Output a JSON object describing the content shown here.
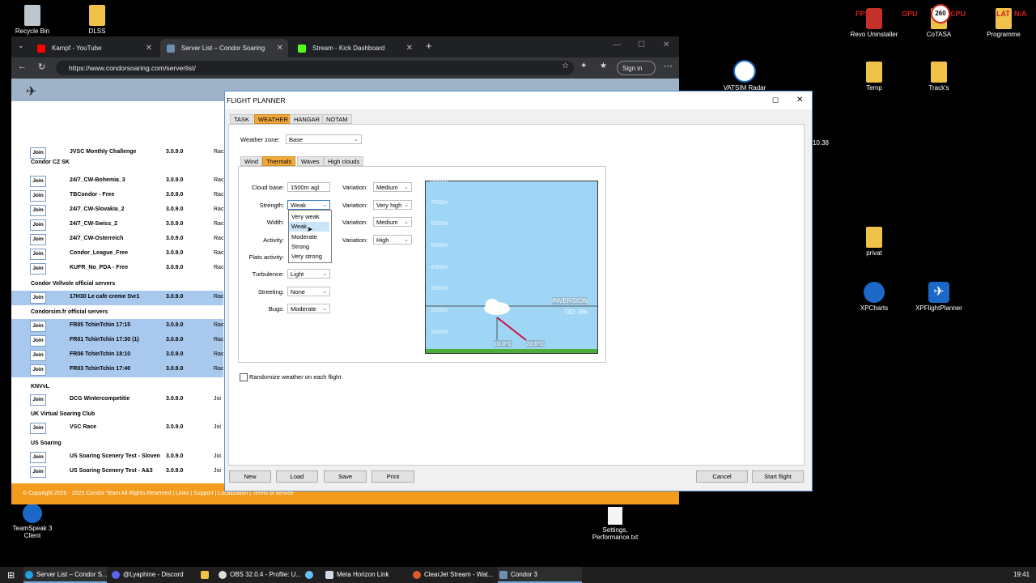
{
  "desktop": {
    "icons_left": [
      {
        "label": "Recycle Bin"
      },
      {
        "label": "DLSS"
      }
    ],
    "icons_right": [
      {
        "label": "Revo Uninstaller"
      },
      {
        "label": "CoTASA"
      },
      {
        "label": "Programme"
      },
      {
        "label": "VATSIM Radar"
      },
      {
        "label": "Temp"
      },
      {
        "label": "Track's"
      },
      {
        "label": "10.38"
      },
      {
        "label": "privat"
      },
      {
        "label": "XPCharts"
      },
      {
        "label": "XPFlightPlanner"
      },
      {
        "label": "Settings, Performance.txt"
      },
      {
        "label": "TeamSpeak 3 Client"
      }
    ],
    "overlay": {
      "fps": "FPS",
      "gpu": "GPU",
      "cpu": "CPU",
      "lat": "LAT",
      "lat_val": "N/A",
      "badge": "260"
    }
  },
  "browser": {
    "tabs": [
      {
        "label": "Kampf - YouTube",
        "fav_color": "#ff0000"
      },
      {
        "label": "Server List – Condor Soaring",
        "fav_color": "#6b8fb5"
      },
      {
        "label": "Stream - Kick Dashboard",
        "fav_color": "#53fc18"
      }
    ],
    "url": "https://www.condorsoaring.com/serverlist/",
    "signin": "Sign in",
    "server_rows": [
      {
        "name": "JVSC Monthly Challenge",
        "version": "3.0.9.0",
        "rc": "Rac",
        "sel": false
      },
      {
        "name": "24/7_CW-Bohemia_3",
        "version": "3.0.9.0",
        "rc": "Rac",
        "sel": false
      },
      {
        "name": "TBCondor - Free",
        "version": "3.0.9.0",
        "rc": "Rac",
        "sel": false
      },
      {
        "name": "24/7_CW-Slovakia_2",
        "version": "3.0.9.0",
        "rc": "Rac",
        "sel": false
      },
      {
        "name": "24/7_CW-Swiss_2",
        "version": "3.0.9.0",
        "rc": "Rac",
        "sel": false
      },
      {
        "name": "24/7_CW-Osterreich",
        "version": "3.0.9.0",
        "rc": "Rac",
        "sel": false
      },
      {
        "name": "Condor_League_Free",
        "version": "3.0.9.0",
        "rc": "Rac",
        "sel": false
      },
      {
        "name": "KUFR_No_PDA - Free",
        "version": "3.0.9.0",
        "rc": "Rac",
        "sel": false
      },
      {
        "name": "17H30 Le cafe creme Svr1",
        "version": "3.0.9.0",
        "rc": "Rac",
        "sel": true
      },
      {
        "name": "FR05 TchinTchin 17:15",
        "version": "3.0.9.0",
        "rc": "Rac",
        "sel": true
      },
      {
        "name": "FR01 TchinTchin 17:30 (1)",
        "version": "3.0.9.0",
        "rc": "Rac",
        "sel": true
      },
      {
        "name": "FR06 TchinTchin 18:10",
        "version": "3.0.9.0",
        "rc": "Rac",
        "sel": true
      },
      {
        "name": "FR03 TchinTchin 17:40",
        "version": "3.0.9.0",
        "rc": "Rac",
        "sel": true
      },
      {
        "name": "DCG Wintercompetitie",
        "version": "3.0.9.0",
        "rc": "Joi",
        "sel": false
      },
      {
        "name": "VSC Race",
        "version": "3.0.9.0",
        "rc": "Joi",
        "sel": false
      },
      {
        "name": "US Soaring Scenery Test - Sloven",
        "version": "3.0.9.0",
        "rc": "Joi",
        "sel": false
      },
      {
        "name": "US Soaring Scenery Test - A&3",
        "version": "3.0.9.0",
        "rc": "Joi",
        "sel": false
      }
    ],
    "join_label": "Join",
    "groups": [
      "Condor CZ SK",
      "Condor Vellvole official servers",
      "Condorsim.fr official servers",
      "KNVvL",
      "UK Virtual Soaring Club",
      "US Soaring"
    ],
    "footer": {
      "copyright": "© Copyright 2020 - 2025",
      "team": "Condor Team",
      "rights": "All Rights Reserved",
      "links": "Links",
      "support": "Support",
      "localization": "Localization",
      "terms": "Terms of service"
    }
  },
  "dialog": {
    "title": "FLIGHT PLANNER",
    "tabs": [
      "TASK",
      "WEATHER",
      "HANGAR",
      "NOTAM"
    ],
    "weather_zone_label": "Weather zone:",
    "weather_zone_value": "Base",
    "subtabs": [
      "Wind",
      "Thermals",
      "Waves",
      "High clouds"
    ],
    "fields": {
      "cloud_base": {
        "label": "Cloud base:",
        "value": "1500m agl"
      },
      "strength": {
        "label": "Strength:",
        "value": "Weak"
      },
      "width": {
        "label": "Width:"
      },
      "activity": {
        "label": "Activity:"
      },
      "flats": {
        "label": "Flats activity:"
      },
      "turbulence": {
        "label": "Turbulence:",
        "value": "Light"
      },
      "streeting": {
        "label": "Streeting:",
        "value": "None"
      },
      "bugs": {
        "label": "Bugs:",
        "value": "Moderate"
      }
    },
    "variations": {
      "label": "Variation:",
      "values": [
        "Medium",
        "Very high",
        "Medium",
        "High"
      ]
    },
    "strength_options": [
      "Very weak",
      "Weak",
      "Moderate",
      "Strong",
      "Very strong"
    ],
    "graph": {
      "alt_labels": [
        "8000m",
        "7000m",
        "6000m",
        "5000m",
        "4000m",
        "3000m",
        "2000m",
        "1000m"
      ],
      "inversion": "INVERSION",
      "od": "OD: 0%",
      "temp_low": "10.0°C",
      "temp_high": "22.0°C"
    },
    "randomize": "Randomize weather on each flight",
    "buttons": {
      "new": "New",
      "load": "Load",
      "save": "Save",
      "print": "Print",
      "cancel": "Cancel",
      "start": "Start flight"
    }
  },
  "taskbar": {
    "items": [
      "Server List – Condor S...",
      "@Lyaphine - Discord",
      "",
      "OBS 32.0.4 - Profile: U...",
      "",
      "Meta Horizon Link",
      "ClearJet Stream - Wat...",
      "Condor 3"
    ],
    "clock": "19:41"
  }
}
